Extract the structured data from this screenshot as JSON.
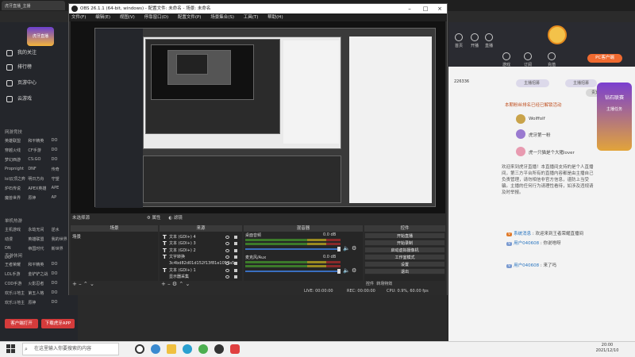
{
  "browser": {
    "tabs": [
      "虎牙直播_主播",
      "直播_王者荣耀",
      "虎牙直播",
      "王者荣耀直播间"
    ]
  },
  "sidebar": {
    "logo_text": "虎牙直播",
    "items": [
      {
        "label": "我的关注",
        "icon": "heart-icon"
      },
      {
        "label": "排行榜",
        "icon": "rank-icon"
      },
      {
        "label": "页游中心",
        "icon": "gamepad-icon"
      },
      {
        "label": "云游戏",
        "icon": "cloud-icon"
      }
    ],
    "section_pc": "网游竞技",
    "pc_games": [
      "英雄联盟",
      "和平精英",
      "DO",
      "穿越火线",
      "CF手游",
      "DO",
      "梦幻西游",
      "CS:GO",
      "DO",
      "Propnight",
      "DNF",
      "传奇",
      "lol云顶之弈",
      "明日方舟",
      "守望",
      "炉石传说",
      "APEX英雄",
      "APE",
      "魔兽世界",
      "原神",
      "AP"
    ],
    "section_single": "单机热游",
    "single_games": [
      "主机游戏",
      "永劫无间",
      "逆水",
      "动漫",
      "英雄联盟",
      "我的世界",
      "DN",
      "帝国时代",
      "新世界",
      "DO"
    ],
    "section_mobile": "手游休闲",
    "mobile_games": [
      "王者荣耀",
      "和平精英",
      "DO",
      "LOL手游",
      "金铲铲之战",
      "DO",
      "COD手游",
      "火影忍者",
      "DO",
      "欢乐斗地主",
      "第五人格",
      "DO",
      "欢乐斗地主",
      "原神",
      "DO"
    ],
    "btn_record": "客户端打开",
    "btn_download": "下载虎牙APP"
  },
  "site_header": {
    "icons": [
      "首页",
      "开播",
      "直播",
      "游戏",
      "订阅",
      "充值",
      "主播中心"
    ],
    "pc_btn": "PC客户端"
  },
  "site_right": {
    "rank_title": "主播招募",
    "rank_num": "226336",
    "contrib_title": "主播招募",
    "contrib_sub": "贵宾",
    "notice": "本期粉丝排名已经已解锁活动",
    "fans": [
      "Wolffolf",
      "虎牙第一粉",
      "虎一只猫是个大猪lover"
    ],
    "welcome": "欢迎来到虎牙直播！本直播间支持的是个人直播间，第三方平台所有的直播内容都是由主播自己负责管理，请勿相信非官方信息，谨防上当受骗。主播的任何行为请理性看待，如涉及违规请及时举报。",
    "msg1_user": "系统消息",
    "msg1_text": "欢迎来到王者荣耀直播间",
    "msg2_user": "用户040608",
    "msg2_text": "你说啥呀",
    "msg3_user": "用户040608",
    "msg3_text": "来了吗",
    "float_badge": "钻石联赛",
    "float_sub": "主播任务"
  },
  "obs": {
    "title": "OBS 26.1.1 (64-bit, windows) - 配置文件: 未命名 - 场景: 未命名",
    "menu": [
      "文件(F)",
      "编辑(E)",
      "视图(V)",
      "停靠窗口(D)",
      "配置文件(P)",
      "场景集合(S)",
      "工具(T)",
      "帮助(H)"
    ],
    "scene_label": "未选择源",
    "props_btn": "属性",
    "filters_btn": "滤镜",
    "docks": {
      "scenes": "场景",
      "sources": "来源",
      "mixer": "混音器",
      "transitions": "转场",
      "controls": "控件"
    },
    "scenes_list": [
      "场景"
    ],
    "sources_list": [
      {
        "type": "T",
        "label": "文本 (GDI+) 4"
      },
      {
        "type": "T",
        "label": "文本 (GDI+) 3"
      },
      {
        "type": "T",
        "label": "文本 (GDI+) 2"
      },
      {
        "type": "T",
        "label": "文字转换"
      },
      {
        "type": "",
        "label": "3c4bd82d01d152f13f81e1057a5"
      },
      {
        "type": "T",
        "label": "文本 (GDI+) 1"
      },
      {
        "type": "",
        "label": "显示器采集"
      }
    ],
    "mixer": [
      {
        "name": "桌面音频",
        "db": "0.0 dB"
      },
      {
        "name": "麦克风/Aux",
        "db": "0.0 dB"
      }
    ],
    "controls": [
      "开始直播",
      "开始录制",
      "启动虚拟摄像机",
      "工作室模式",
      "设置",
      "退出"
    ],
    "controls_tabs": [
      "控件",
      "转场特效"
    ],
    "status": {
      "live": "LIVE: 00:00:00",
      "rec": "REC: 00:00:00",
      "cpu": "CPU: 0.9%, 60.00 fps"
    }
  },
  "taskbar": {
    "search_placeholder": "在这里输入你要搜索的内容",
    "time": "20:00",
    "date": "2021/12/10"
  }
}
